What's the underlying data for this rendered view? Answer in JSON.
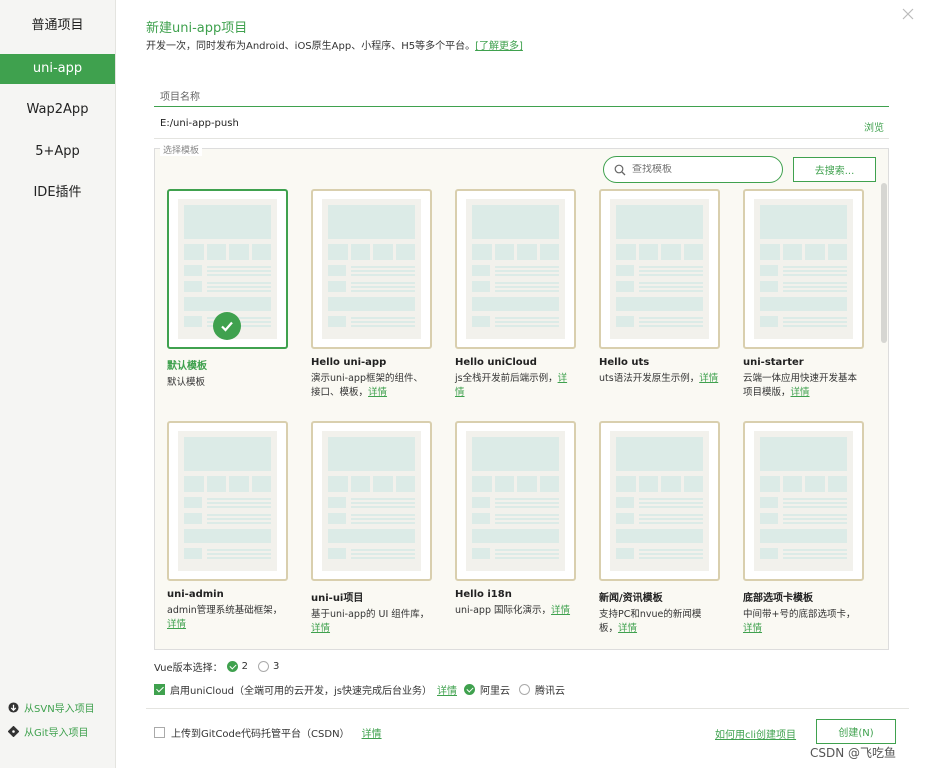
{
  "sidebar": {
    "items": [
      {
        "label": "普通项目"
      },
      {
        "label": "uni-app"
      },
      {
        "label": "Wap2App"
      },
      {
        "label": "5+App"
      },
      {
        "label": "IDE插件"
      }
    ],
    "svn_import": "从SVN导入项目",
    "git_import": "从Git导入项目"
  },
  "header": {
    "title": "新建uni-app项目",
    "subtitle": "开发一次，同时发布为Android、iOS原生App、小程序、H5等多个平台。",
    "learn_more": "[了解更多]"
  },
  "form": {
    "name_label": "项目名称",
    "path_value": "E:/uni-app-push",
    "browse": "浏览"
  },
  "templates": {
    "legend": "选择模板",
    "search_placeholder": "查找模板",
    "search_button": "去搜索...",
    "detail_link": "详情",
    "cards": [
      {
        "name": "默认模板",
        "desc": "默认模板",
        "has_link": false,
        "selected": true
      },
      {
        "name": "Hello uni-app",
        "desc": "演示uni-app框架的组件、接口、模板，",
        "has_link": true
      },
      {
        "name": "Hello uniCloud",
        "desc": "js全栈开发前后端示例，",
        "has_link": true
      },
      {
        "name": "Hello uts",
        "desc": "uts语法开发原生示例，",
        "has_link": true
      },
      {
        "name": "uni-starter",
        "desc": "云端一体应用快速开发基本项目模版，",
        "has_link": true
      },
      {
        "name": "uni-admin",
        "desc": "admin管理系统基础框架，",
        "has_link": true
      },
      {
        "name": "uni-ui项目",
        "desc": "基于uni-app的 UI 组件库，",
        "has_link": true
      },
      {
        "name": "Hello i18n",
        "desc": "uni-app 国际化演示，",
        "has_link": true
      },
      {
        "name": "新闻/资讯模板",
        "desc": "支持PC和nvue的新闻模板，",
        "has_link": true
      },
      {
        "name": "底部选项卡模板",
        "desc": "中间带+号的底部选项卡，",
        "has_link": true
      }
    ]
  },
  "options": {
    "vue_label": "Vue版本选择：",
    "vue_2": "2",
    "vue_3": "3",
    "vue_selected": "2",
    "unicloud_label": "启用uniCloud（全端可用的云开发，js快速完成后台业务）",
    "unicloud_detail": "详情",
    "provider_aliyun": "阿里云",
    "provider_tencent": "腾讯云",
    "unicloud_enabled": true,
    "upload_label": "上传到GitCode代码托管平台（CSDN）",
    "upload_detail": "详情",
    "cli_link": "如何用cli创建项目",
    "create_button": "创建(N)"
  },
  "watermark": "CSDN @飞吃鱼",
  "colors": {
    "accent": "#3fa14e",
    "card_border": "#d9cfae",
    "thumb_block": "#dcebe7"
  }
}
